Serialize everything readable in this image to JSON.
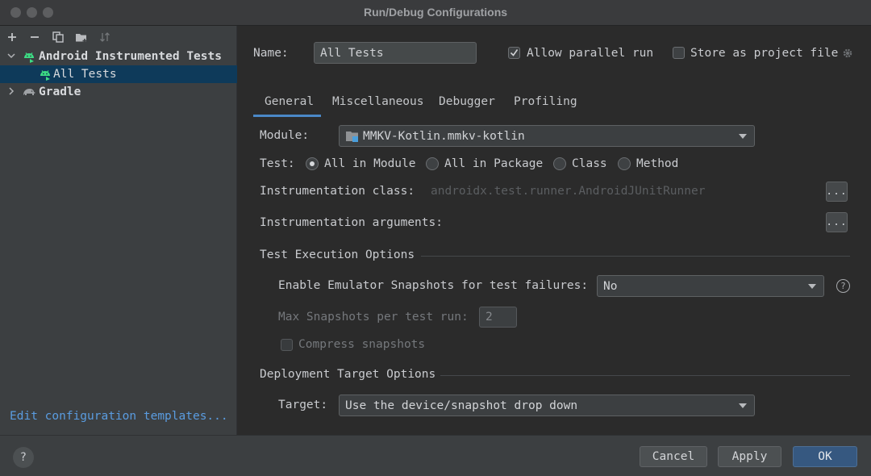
{
  "window": {
    "title": "Run/Debug Configurations"
  },
  "toolbar": {
    "icons": [
      "plus-icon",
      "minus-icon",
      "copy-icon",
      "folder-add-icon",
      "sort-icon"
    ]
  },
  "tree": {
    "android_group": "Android Instrumented Tests",
    "all_tests": "All Tests",
    "gradle": "Gradle"
  },
  "sidebar": {
    "edit_templates_link": "Edit configuration templates..."
  },
  "header": {
    "name_label": "Name:",
    "name_value": "All Tests",
    "allow_parallel_label": "Allow parallel run",
    "allow_parallel_checked": true,
    "store_project_label": "Store as project file",
    "store_project_checked": false
  },
  "tabs": [
    {
      "label": "General",
      "active": true
    },
    {
      "label": "Miscellaneous",
      "active": false
    },
    {
      "label": "Debugger",
      "active": false
    },
    {
      "label": "Profiling",
      "active": false
    }
  ],
  "general": {
    "module_label": "Module:",
    "module_value": "MMKV-Kotlin.mmkv-kotlin",
    "test_label": "Test:",
    "test_options": [
      {
        "label": "All in Module",
        "selected": true
      },
      {
        "label": "All in Package",
        "selected": false
      },
      {
        "label": "Class",
        "selected": false
      },
      {
        "label": "Method",
        "selected": false
      }
    ],
    "instrumentation_class_label": "Instrumentation class:",
    "instrumentation_class_value": "androidx.test.runner.AndroidJUnitRunner",
    "instrumentation_args_label": "Instrumentation arguments:",
    "dots_label": "..."
  },
  "test_execution": {
    "section_title": "Test Execution Options",
    "snapshots_label": "Enable Emulator Snapshots for test failures:",
    "snapshots_value": "No",
    "max_snapshots_label": "Max Snapshots per test run:",
    "max_snapshots_value": "2",
    "compress_label": "Compress snapshots",
    "compress_checked": false
  },
  "deployment": {
    "section_title": "Deployment Target Options",
    "target_label": "Target:",
    "target_value": "Use the device/snapshot drop down"
  },
  "footer": {
    "help_label": "?",
    "cancel_label": "Cancel",
    "apply_label": "Apply",
    "ok_label": "OK"
  },
  "colors": {
    "accent": "#4a88c7",
    "selection": "#0e3a5a",
    "link": "#5a9ce0",
    "primary_button": "#365880",
    "android_green": "#3ddc84"
  }
}
